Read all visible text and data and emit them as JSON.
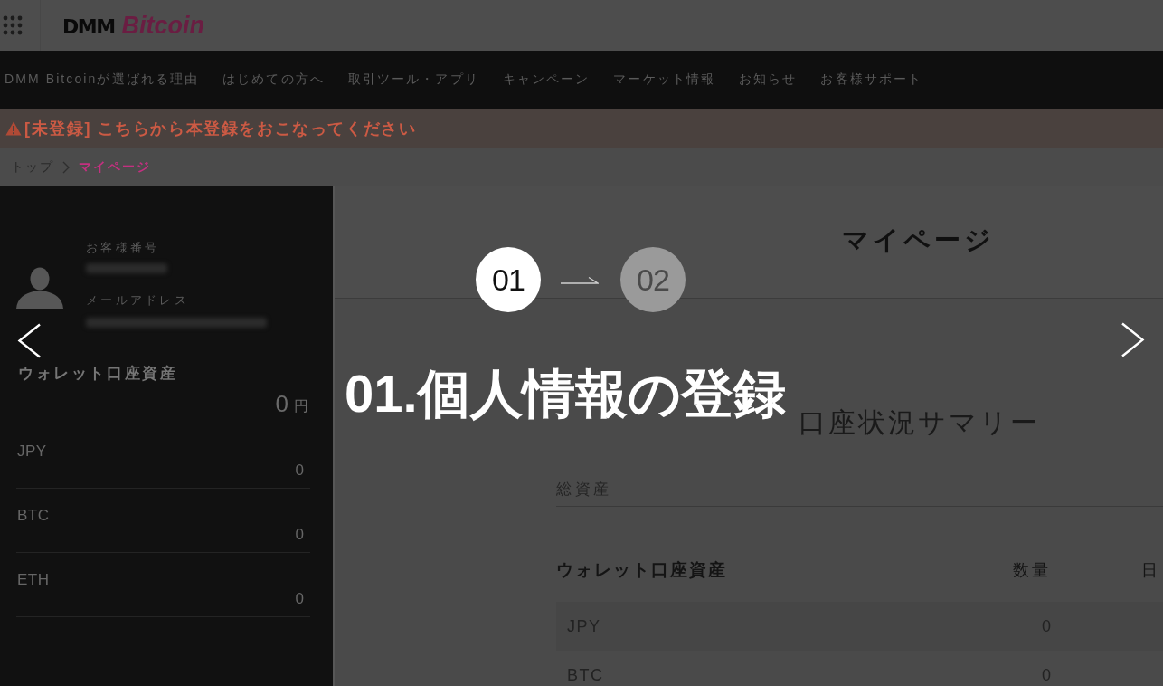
{
  "header": {
    "logo": "**DMM** *Bitcoin*"
  },
  "nav": [
    "DMM Bitcoinが選ばれる理由",
    "はじめての方へ",
    "取引ツール・アプリ",
    "キャンペーン",
    "マーケット情報",
    "お知らせ",
    "お客様サポート"
  ],
  "alert": {
    "message": "[未登録] こちらから本登録をおこなってください"
  },
  "breadcrumb": [
    {
      "label": "トップ",
      "selected": false
    },
    {
      "label": "マイページ",
      "selected": true
    }
  ],
  "sidebar": {
    "customer_number_label": "お客様番号",
    "email_label": "メールアドレス",
    "wallet": {
      "title": "ウォレット口座資産",
      "total": "0",
      "unit": "円",
      "assets": [
        {
          "name": "JPY",
          "amount": "0"
        },
        {
          "name": "BTC",
          "amount": "0"
        },
        {
          "name": "ETH",
          "amount": "0"
        }
      ]
    }
  },
  "main": {
    "title": "マイページ",
    "summary": {
      "title": "口座状況サマリー",
      "total_assets_label": "総資産",
      "wallet_table": {
        "columns": [
          "ウォレット口座資産",
          "数量",
          "日"
        ],
        "rows": [
          {
            "name": "JPY",
            "amount": "0"
          },
          {
            "name": "BTC",
            "amount": "0"
          }
        ]
      }
    }
  },
  "tutorial": {
    "steps": [
      {
        "label": "01",
        "selected": true
      },
      {
        "label": "02",
        "selected": false
      }
    ],
    "title": "01.個人情報の登録"
  }
}
